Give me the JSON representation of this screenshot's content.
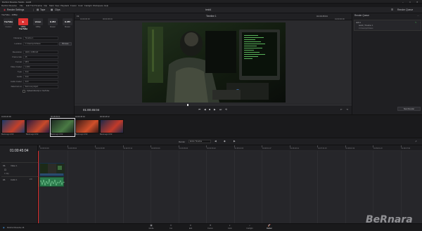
{
  "window": {
    "title": "DaVinci Resolve Studio - testt4"
  },
  "menu": [
    "DaVinci Resolve",
    "File",
    "Edit",
    "Trim",
    "Timeline",
    "Clip",
    "Mark",
    "View",
    "Playback",
    "Fusion",
    "Color",
    "Fairlight",
    "Workspace",
    "Help"
  ],
  "toolbar": {
    "render_settings": "Render Settings",
    "render_settings_sub": "YouTube - 1080p",
    "clips": "Clips",
    "project": "testt4",
    "render_queue_btn": "Render Queue"
  },
  "presets": [
    {
      "icon": "YouTube",
      "label": "Custom"
    },
    {
      "icon": "▶ YouTube",
      "label": "1080p"
    },
    {
      "icon": "vimeo",
      "label": "1080p"
    },
    {
      "icon": "H.264",
      "label": "Master"
    },
    {
      "icon": "H.265",
      "label": "Master"
    }
  ],
  "settings": [
    {
      "k": "Filename",
      "v": "Timeline 1"
    },
    {
      "k": "Location",
      "v": "C:\\Users\\pc\\Videos"
    },
    {
      "k": "Resolution",
      "v": "1920 x 1080 HD"
    },
    {
      "k": "Frame rate",
      "v": "25"
    },
    {
      "k": "Format",
      "v": "MP4"
    },
    {
      "k": "Video Codec",
      "v": "H.264"
    },
    {
      "k": "Type",
      "v": "Auto"
    },
    {
      "k": "Audio",
      "v": "Auto"
    },
    {
      "k": "Audio Codec",
      "v": "AAC"
    },
    {
      "k": "Data burn-in",
      "v": "Same as project"
    }
  ],
  "browse_label": "Browse",
  "upload_label": "Upload directly to YouTube",
  "add_queue_label": "Add to Render Queue",
  "viewer": {
    "fit": "Fit",
    "title": "Timeline 1",
    "tc_left": "01:00:00:00",
    "tc_right": "01:00:45:04",
    "duration_label": "00:00:45:04",
    "current_tc": "01:00:45:04"
  },
  "queue": {
    "title": "Render Queue",
    "job": "Job 1",
    "job_name": "testt4 | Timeline 1",
    "job_path": "C:\\Users\\pc\\Videos",
    "render_btn": "Start Render"
  },
  "thumbs": [
    {
      "tc": "01:00:20:09",
      "name": "Blackmagic DHR"
    },
    {
      "tc": "",
      "name": "Blackmagic DHR"
    },
    {
      "tc": "00:18:39:11",
      "name": "Blackmagic DHR"
    },
    {
      "tc": "01:00:45:04",
      "name": "Blackmagic DHR"
    },
    {
      "tc": "00:30:18:12",
      "name": "Blackmagic DHR"
    }
  ],
  "timeline": {
    "current_tc": "01:00:45:04",
    "label": "Render",
    "selector": "Entire Timeline",
    "v1": "Video 1",
    "v1_id": "V1",
    "a1": "Audio 1",
    "a1_id": "A1",
    "a1_val": "2.0",
    "clips_count": "1 Clip",
    "ruler": [
      "01:00:00:00",
      "01:00:45:04",
      "01:01:30:08",
      "01:02:15:12",
      "01:03:00:16",
      "01:03:45:20",
      "01:04:30:24",
      "01:05:16:03",
      "01:06:01:07",
      "01:06:46:11",
      "01:07:31:15",
      "01:08:16:19",
      "01:09:01:23",
      "01:09:47:02"
    ]
  },
  "pages": [
    {
      "icon": "▣",
      "label": "Media"
    },
    {
      "icon": "⟐",
      "label": "Cut"
    },
    {
      "icon": "≡",
      "label": "Edit"
    },
    {
      "icon": "✦",
      "label": "Fusion"
    },
    {
      "icon": "◐",
      "label": "Color"
    },
    {
      "icon": "♪",
      "label": "Fairlight"
    },
    {
      "icon": "🚀",
      "label": "Deliver"
    }
  ],
  "app_name": "DaVinci Resolve 16",
  "watermark": "BeRnara"
}
